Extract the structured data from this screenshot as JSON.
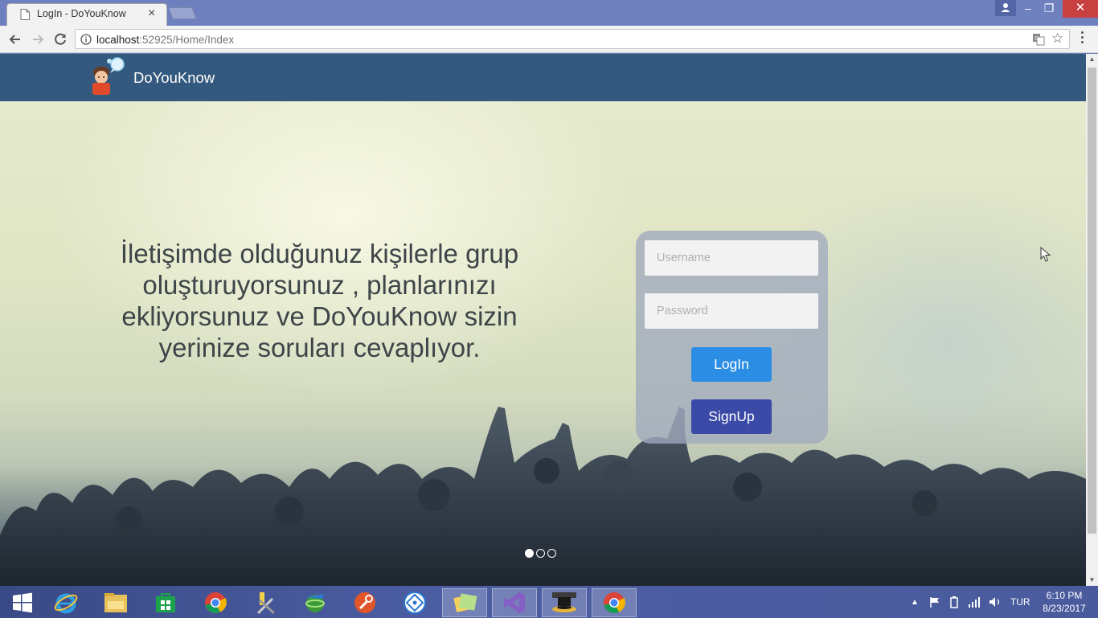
{
  "browser": {
    "tab_title": "LogIn - DoYouKnow",
    "tab_close": "×",
    "url_host": "localhost",
    "url_path": ":52925/Home/Index",
    "star_glyph": "☆",
    "win_min": "–",
    "win_max": "❐",
    "win_close": "✕"
  },
  "site": {
    "brand": "DoYouKnow",
    "tagline": "İletişimde olduğunuz kişilerle grup oluşturuyorsunuz , planlarınızı ekliyorsunuz ve DoYouKnow sizin yerinize soruları cevaplıyor.",
    "login": {
      "username_placeholder": "Username",
      "password_placeholder": "Password",
      "login_label": "LogIn",
      "signup_label": "SignUp"
    },
    "carousel": {
      "slides": 3,
      "active": 1
    }
  },
  "taskbar": {
    "language": "TUR",
    "time": "6:10 PM",
    "date": "8/23/2017",
    "apps": [
      "start-icon",
      "internet-explorer-icon",
      "file-explorer-icon",
      "store-icon",
      "chrome-icon",
      "tools-icon",
      "network-globe-icon",
      "wrench-app-icon",
      "remote-desktop-icon",
      "sticky-notes-icon",
      "visual-studio-icon",
      "hat-app-icon",
      "chrome-active-icon"
    ]
  },
  "colors": {
    "navbar": "#34597e",
    "login_button": "#2b8ee4",
    "signup_button": "#3a4aa6",
    "card": "#a0aabe"
  }
}
